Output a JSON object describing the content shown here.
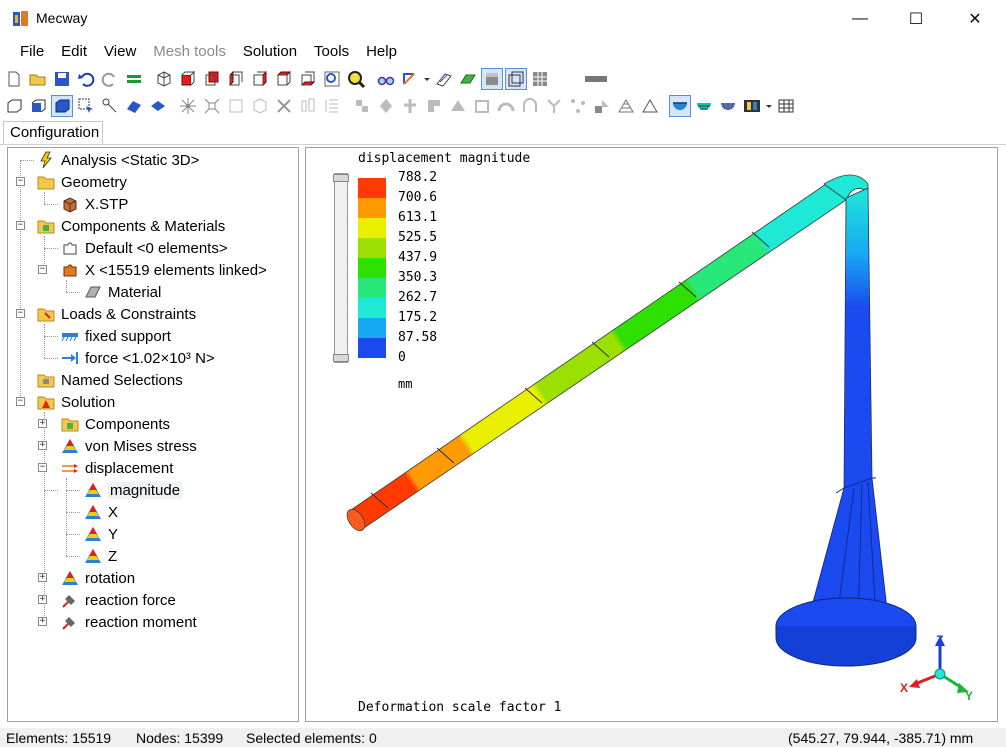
{
  "window": {
    "title": "Mecway",
    "minimize": "—",
    "maximize": "☐",
    "close": "✕"
  },
  "menu": [
    "File",
    "Edit",
    "View",
    "Mesh tools",
    "Solution",
    "Tools",
    "Help"
  ],
  "menu_disabled": [
    "Mesh tools"
  ],
  "tab": {
    "label": "Configuration"
  },
  "tree": {
    "analysis": "Analysis <Static 3D>",
    "geometry": "Geometry",
    "geometry_file": "X.STP",
    "components_materials": "Components & Materials",
    "default_component": "Default <0 elements>",
    "x_component": "X <15519 elements linked>",
    "material": "Material",
    "loads_constraints": "Loads & Constraints",
    "fixed_support": "fixed support",
    "force": "force <1.02×10³ N>",
    "named_selections": "Named Selections",
    "solution": "Solution",
    "components": "Components",
    "von_mises": "von Mises stress",
    "displacement": "displacement",
    "magnitude": "magnitude",
    "disp_x": "X",
    "disp_y": "Y",
    "disp_z": "Z",
    "rotation": "rotation",
    "reaction_force": "reaction force",
    "reaction_moment": "reaction moment"
  },
  "view": {
    "title": "displacement magnitude",
    "legend": {
      "values": [
        "788.2",
        "700.6",
        "613.1",
        "525.5",
        "437.9",
        "350.3",
        "262.7",
        "175.2",
        "87.58",
        "0"
      ],
      "colors": [
        "#ff3a00",
        "#ff9a00",
        "#e8f000",
        "#9be000",
        "#2ee000",
        "#27e878",
        "#1ee8d6",
        "#18a8f2",
        "#1a4af0"
      ],
      "unit": "mm"
    },
    "deformation": "Deformation scale factor 1",
    "axes": {
      "x": "X",
      "y": "Y",
      "z": "Z"
    },
    "model_body_color": "#1a4af0",
    "model_top_color": "#1ee8d6"
  },
  "status": {
    "elements": "Elements: 15519",
    "nodes": "Nodes: 15399",
    "selected": "Selected elements: 0",
    "coords": "(545.27, 79.944, -385.71) mm"
  }
}
